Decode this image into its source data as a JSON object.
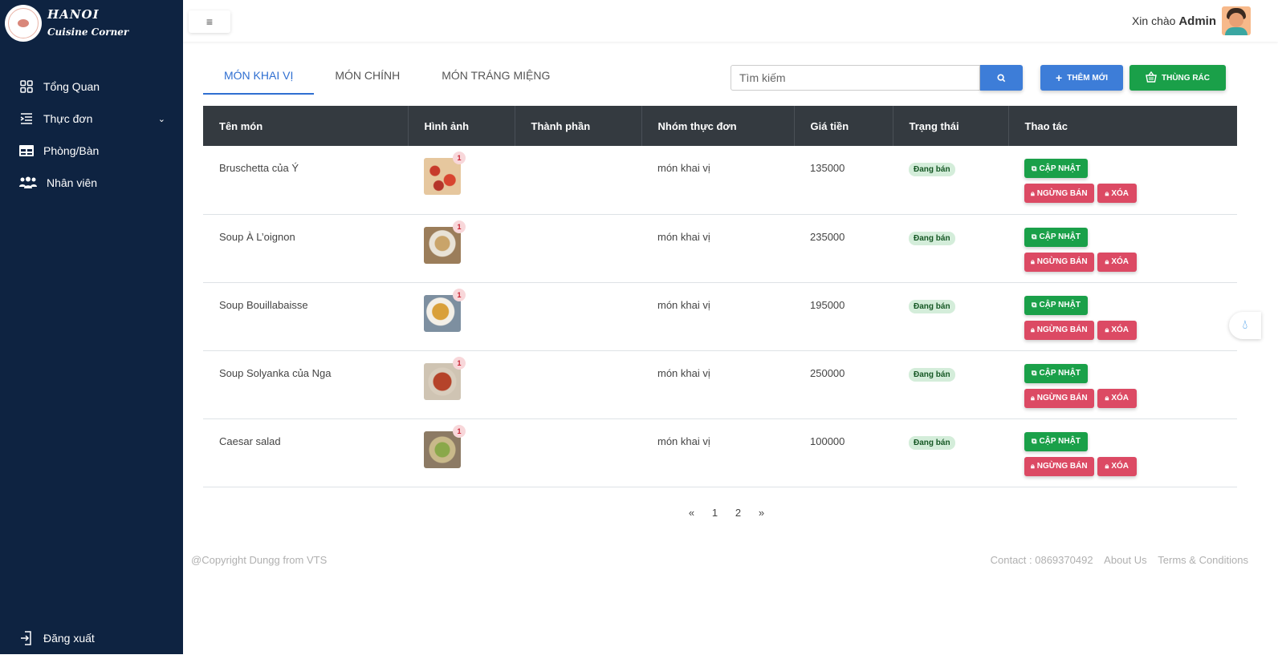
{
  "brand": {
    "line1": "HANOI",
    "line2": "Cuisine Corner"
  },
  "sidebar": {
    "items": [
      {
        "label": "Tổng Quan",
        "icon": "grid-icon"
      },
      {
        "label": "Thực đơn",
        "icon": "menu-list-icon"
      },
      {
        "label": "Phòng/Bàn",
        "icon": "table-icon"
      },
      {
        "label": "Nhân viên",
        "icon": "users-icon"
      }
    ],
    "logout": "Đăng xuất"
  },
  "header": {
    "greeting": "Xin chào",
    "user": "Admin",
    "menu_toggle": "≡"
  },
  "tabs": [
    {
      "label": "MÓN KHAI VỊ",
      "active": true
    },
    {
      "label": "MÓN CHÍNH",
      "active": false
    },
    {
      "label": "MÓN TRÁNG MIỆNG",
      "active": false
    }
  ],
  "search": {
    "placeholder": "Tìm kiếm"
  },
  "buttons": {
    "add": "THÊM MỚI",
    "trash": "THÙNG RÁC"
  },
  "table": {
    "headers": [
      "Tên món",
      "Hình ảnh",
      "Thành phần",
      "Nhóm thực đơn",
      "Giá tiền",
      "Trạng thái",
      "Thao tác"
    ],
    "rows": [
      {
        "name": "Bruschetta của Ý",
        "image_count": "1",
        "ingredients": "",
        "group": "món khai vị",
        "price": "135000",
        "status": "Đang bán"
      },
      {
        "name": "Soup À L’oignon",
        "image_count": "1",
        "ingredients": "",
        "group": "món khai vị",
        "price": "235000",
        "status": "Đang bán"
      },
      {
        "name": "Soup Bouillabaisse",
        "image_count": "1",
        "ingredients": "",
        "group": "món khai vị",
        "price": "195000",
        "status": "Đang bán"
      },
      {
        "name": "Soup Solyanka của Nga",
        "image_count": "1",
        "ingredients": "",
        "group": "món khai vị",
        "price": "250000",
        "status": "Đang bán"
      },
      {
        "name": "Caesar salad",
        "image_count": "1",
        "ingredients": "",
        "group": "món khai vị",
        "price": "100000",
        "status": "Đang bán"
      }
    ],
    "actions": {
      "update": "CẬP NHẬT",
      "stop": "NGỪNG BÁN",
      "delete": "XÓA"
    }
  },
  "pagination": {
    "prev": "«",
    "pages": [
      "1",
      "2"
    ],
    "next": "»"
  },
  "footer": {
    "copyright": "@Copyright Dungg from VTS",
    "contact": "Contact : 0869370492",
    "about": "About Us",
    "terms": "Terms & Conditions"
  },
  "colors": {
    "sidebar_bg": "#0e2341",
    "primary": "#3d7dd8",
    "success": "#1aa049",
    "danger": "#dc4a64",
    "table_header": "#343a40"
  }
}
